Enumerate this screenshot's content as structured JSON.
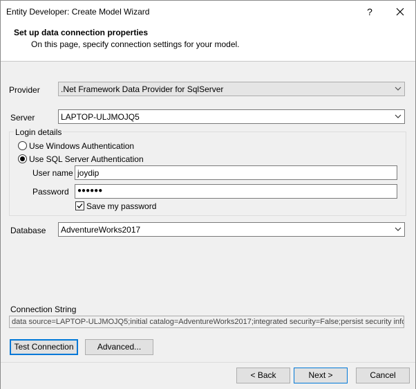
{
  "window": {
    "title": "Entity Developer: Create Model Wizard",
    "help_label": "?"
  },
  "header": {
    "title": "Set up data connection properties",
    "subtitle": "On this page, specify connection settings for your model."
  },
  "provider": {
    "label": "Provider",
    "value": ".Net Framework Data Provider for SqlServer",
    "enabled": false
  },
  "server": {
    "label": "Server",
    "value": "LAPTOP-ULJMOJQ5"
  },
  "login": {
    "group_label": "Login details",
    "windows_auth_label": "Use Windows Authentication",
    "windows_auth_selected": false,
    "sql_auth_label": "Use SQL Server Authentication",
    "sql_auth_selected": true,
    "username_label": "User name",
    "username_value": "joydip",
    "password_label": "Password",
    "password_value": "●●●●●●",
    "save_password_label": "Save my password",
    "save_password_checked": true
  },
  "database": {
    "label": "Database",
    "value": "AdventureWorks2017"
  },
  "connection_string": {
    "label": "Connection String",
    "value": "data source=LAPTOP-ULJMOJQ5;initial catalog=AdventureWorks2017;integrated security=False;persist security info=True;us"
  },
  "buttons": {
    "test_connection": "Test Connection",
    "advanced": "Advanced...",
    "back": "< Back",
    "next": "Next >",
    "cancel": "Cancel"
  },
  "icons": {
    "close": "close-icon",
    "dropdown": "chevron-down-icon",
    "check": "check-icon"
  }
}
